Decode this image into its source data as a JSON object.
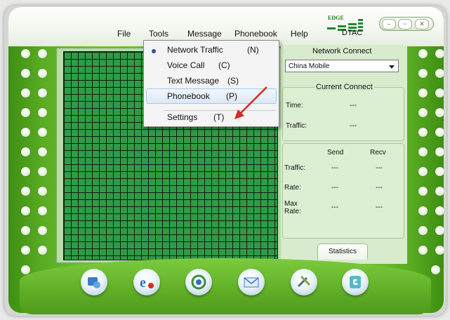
{
  "menubar": {
    "file": "File",
    "tools": "Tools",
    "message": "Message",
    "phonebook": "Phonebook",
    "help": "Help"
  },
  "status": {
    "network_type": "EDGE",
    "carrier": "DTAC"
  },
  "tools_menu": {
    "items": [
      {
        "label": "Network Traffic",
        "key": "(N)",
        "selected": true
      },
      {
        "label": "Voice Call",
        "key": "(C)"
      },
      {
        "label": "Text Message",
        "key": "(S)"
      },
      {
        "label": "Phonebook",
        "key": "(P)",
        "highlighted": true
      },
      {
        "label": "Settings",
        "key": "(T)"
      }
    ]
  },
  "network_connect": {
    "title": "Network Connect",
    "selected_network": "China Mobile"
  },
  "current_connect": {
    "title": "Current Connect",
    "time_label": "Time:",
    "time_value": "---",
    "traffic_label": "Traffic:",
    "traffic_value": "---"
  },
  "stats": {
    "send_header": "Send",
    "recv_header": "Recv",
    "rows": [
      {
        "label": "Traffic:",
        "send": "---",
        "recv": "---"
      },
      {
        "label": "Rate:",
        "send": "---",
        "recv": "---"
      },
      {
        "label": "Max Rate:",
        "send": "---",
        "recv": "---"
      }
    ],
    "tab_label": "Statistics"
  },
  "toolbar": {
    "buttons": [
      "connect-icon",
      "internet-icon",
      "sync-icon",
      "message-icon",
      "tools-icon",
      "phonebook-icon"
    ]
  },
  "colors": {
    "frame_green": "#66b82b",
    "grid_green": "#2f9b46",
    "accent_red": "#d62a1f"
  }
}
